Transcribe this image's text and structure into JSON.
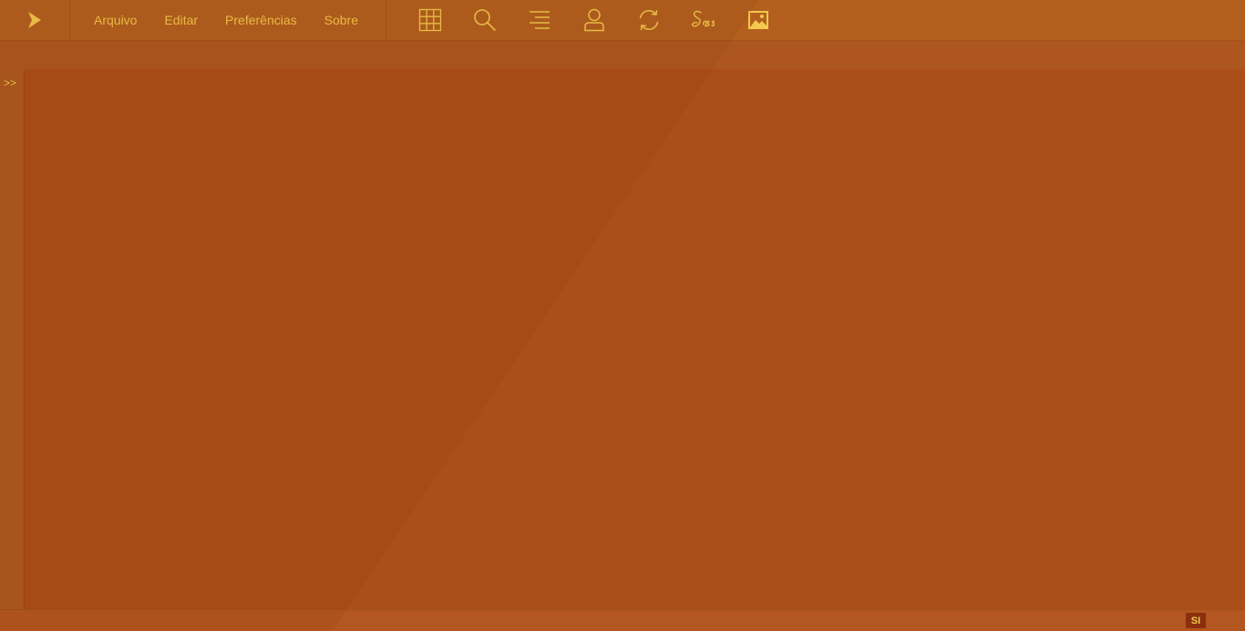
{
  "menu": {
    "items": [
      "Arquivo",
      "Editar",
      "Preferências",
      "Sobre"
    ]
  },
  "toolbar": {
    "icons": [
      "grid-icon",
      "search-icon",
      "align-right-icon",
      "user-icon",
      "refresh-icon",
      "sass-icon",
      "image-icon"
    ]
  },
  "gutter": {
    "toggle_label": ">>"
  },
  "status": {
    "badge": "SI"
  },
  "colors": {
    "accent": "#f2c94c",
    "background": "#ad4f19",
    "topbar": "#b3601f",
    "badge_bg": "#8b2f0e"
  }
}
